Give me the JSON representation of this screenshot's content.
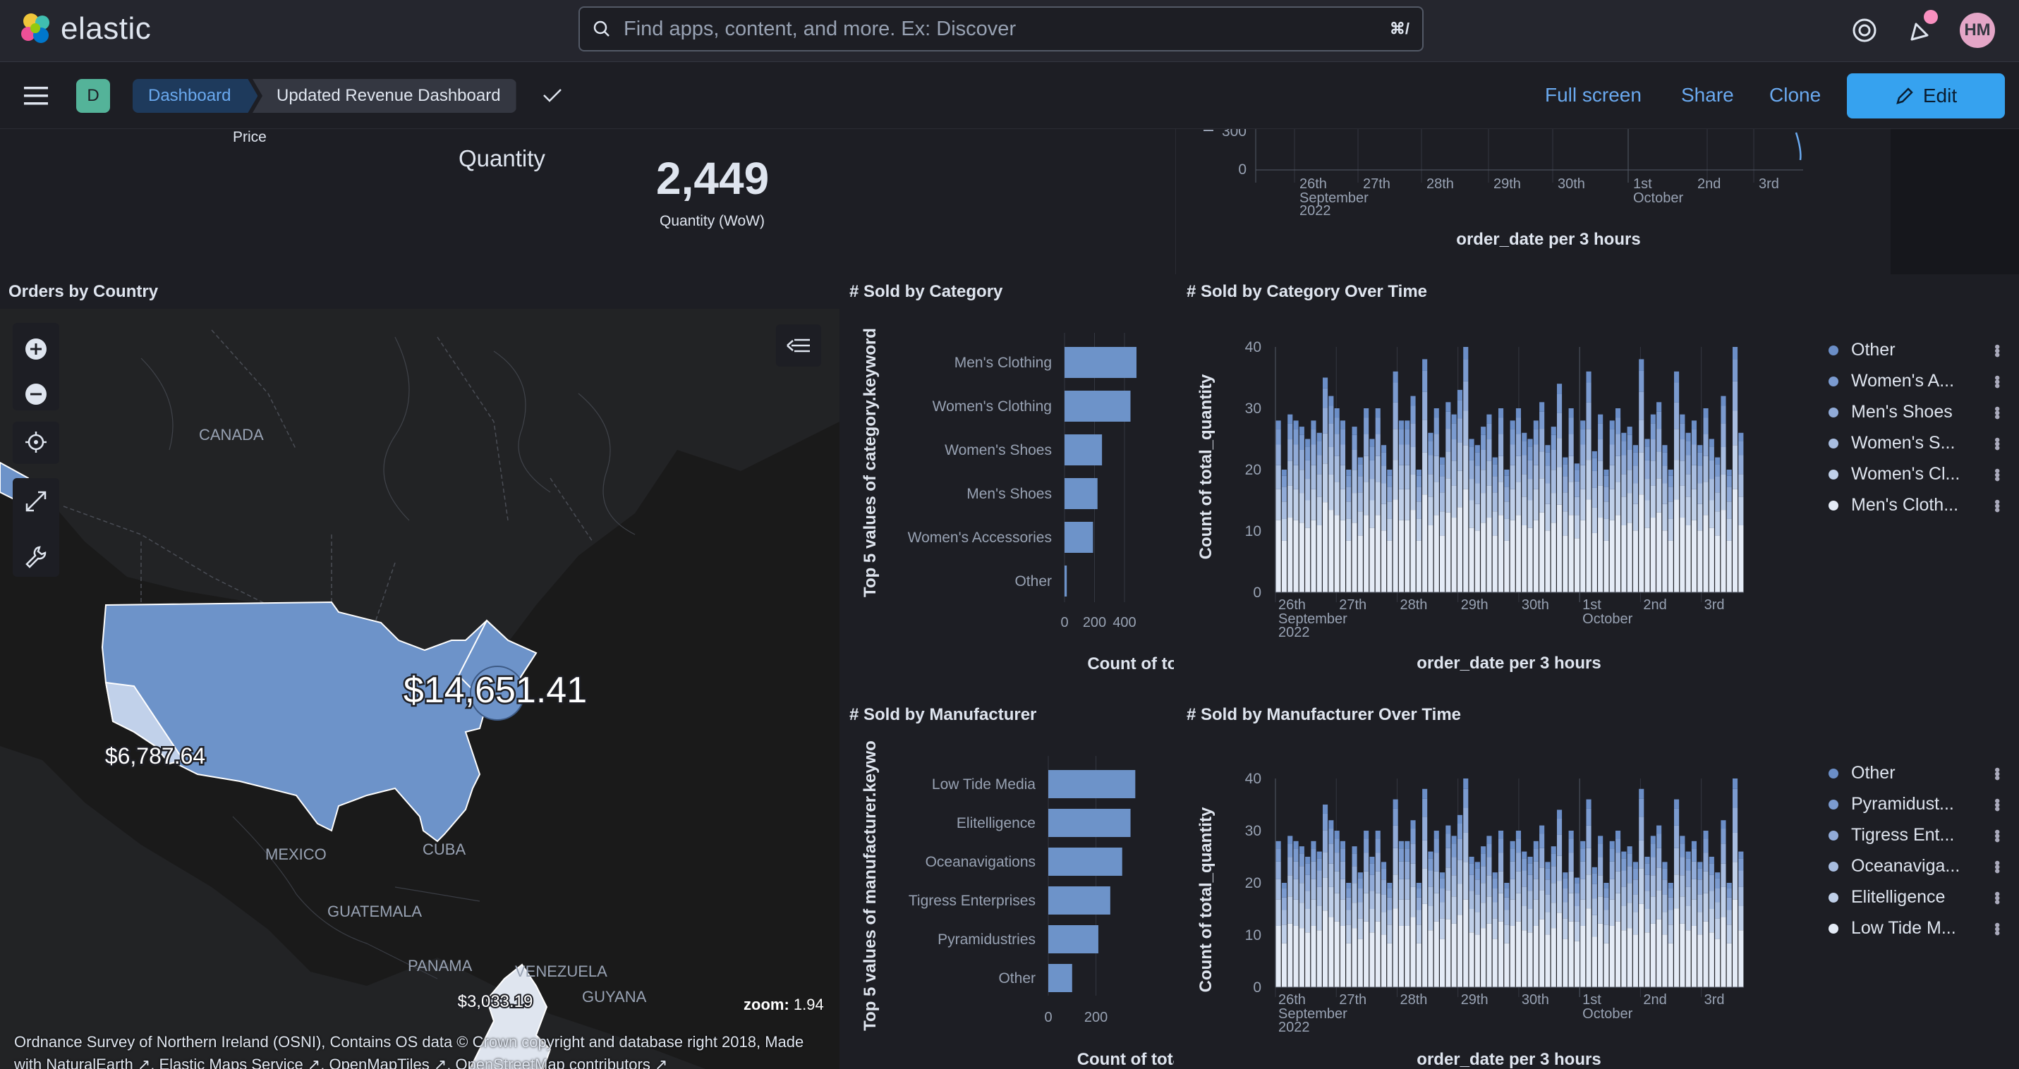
{
  "app": {
    "brand": "elastic",
    "user_initials": "HM"
  },
  "search": {
    "placeholder": "Find apps, content, and more. Ex: Discover",
    "shortcut": "⌘/"
  },
  "breadcrumb": {
    "root": "Dashboard",
    "current": "Updated Revenue Dashboard",
    "workspace_initial": "D"
  },
  "actions": {
    "fullscreen": "Full screen",
    "share": "Share",
    "clone": "Clone",
    "edit": "Edit"
  },
  "top_panels": {
    "price_label": "Price",
    "quantity_title": "Quantity",
    "quantity_value": "2,449",
    "quantity_sub": "Quantity (WoW)",
    "timeline_title": "order_date per 3 hours",
    "timeline_yticks": [
      "300",
      "0"
    ],
    "timeline_xticks": [
      "26th",
      "27th",
      "28th",
      "29th",
      "30th",
      "1st",
      "2nd",
      "3rd"
    ],
    "timeline_sub1": "September",
    "timeline_sub1b": "2022",
    "timeline_sub2": "October"
  },
  "map": {
    "title": "Orders by Country",
    "labels": {
      "canada": "CANADA",
      "mexico": "MEXICO",
      "cuba": "CUBA",
      "guatemala": "GUATEMALA",
      "panama": "PANAMA",
      "venezuela": "VENEZUELA",
      "guyana": "GUYANA"
    },
    "values": {
      "usa": "$14,651.41",
      "west": "$6,787.64",
      "colombia": "$3,033.19"
    },
    "zoom_label": "zoom:",
    "zoom_value": "1.94",
    "attribution_line1": "Ordnance Survey of Northern Ireland (OSNI), Contains OS data © Crown copyright and database right 2018, Made",
    "attribution_line2": "with NaturalEarth ↗, Elastic Maps Service ↗, OpenMapTiles ↗, OpenStreetMap contributors ↗"
  },
  "sold_by_category": {
    "title": "# Sold by Category",
    "ylabel": "Top 5 values of category.keyword",
    "xlabel": "Count of total_quar",
    "xticks": [
      "0",
      "200",
      "400"
    ]
  },
  "sold_by_manufacturer": {
    "title": "# Sold by Manufacturer",
    "ylabel": "Top 5 values of manufacturer.keywo",
    "xlabel": "Count of total_quant",
    "xticks": [
      "0",
      "200"
    ]
  },
  "category_over_time": {
    "title": "# Sold by Category Over Time",
    "ylabel": "Count of total_quantity",
    "xlabel": "order_date per 3 hours",
    "yticks": [
      "40",
      "30",
      "20",
      "10",
      "0"
    ],
    "xticks": [
      "26th",
      "27th",
      "28th",
      "29th",
      "30th",
      "1st",
      "2nd",
      "3rd"
    ],
    "sub1": "September",
    "sub1b": "2022",
    "sub2": "October",
    "legend": [
      "Other",
      "Women's A...",
      "Men's Shoes",
      "Women's S...",
      "Women's Cl...",
      "Men's Cloth..."
    ]
  },
  "manufacturer_over_time": {
    "title": "# Sold by Manufacturer Over Time",
    "ylabel": "Count of total_quantity",
    "xlabel": "order_date per 3 hours",
    "yticks": [
      "40",
      "30",
      "20",
      "10",
      "0"
    ],
    "xticks": [
      "26th",
      "27th",
      "28th",
      "29th",
      "30th",
      "1st",
      "2nd",
      "3rd"
    ],
    "sub1": "September",
    "sub1b": "2022",
    "sub2": "October",
    "legend": [
      "Other",
      "Pyramidust...",
      "Tigress Ent...",
      "Oceanaviga...",
      "Elitelligence",
      "Low Tide M..."
    ]
  },
  "chart_data": [
    {
      "type": "bar",
      "orientation": "horizontal",
      "title": "# Sold by Category",
      "categories": [
        "Men's Clothing",
        "Women's Clothing",
        "Women's Shoes",
        "Men's Shoes",
        "Women's Accessories",
        "Other"
      ],
      "values": [
        480,
        440,
        250,
        220,
        190,
        15
      ],
      "xlabel": "Count of total_quar",
      "ylabel": "Top 5 values of category.keyword",
      "xlim": [
        0,
        480
      ]
    },
    {
      "type": "bar",
      "orientation": "horizontal",
      "title": "# Sold by Manufacturer",
      "categories": [
        "Low Tide Media",
        "Elitelligence",
        "Oceanavigations",
        "Tigress Enterprises",
        "Pyramidustries",
        "Other"
      ],
      "values": [
        365,
        345,
        310,
        260,
        210,
        100
      ],
      "xlabel": "Count of total_quant",
      "ylabel": "Top 5 values of manufacturer.keywo",
      "xlim": [
        0,
        370
      ]
    },
    {
      "type": "bar",
      "stacked": true,
      "title": "# Sold by Category Over Time",
      "series_names": [
        "Other",
        "Women's A...",
        "Men's Shoes",
        "Women's S...",
        "Women's Cl...",
        "Men's Cloth..."
      ],
      "totals": [
        28,
        20,
        29,
        28,
        27,
        25,
        28,
        26,
        35,
        32,
        30,
        28,
        20,
        27,
        22,
        30,
        25,
        30,
        24,
        20,
        36,
        28,
        28,
        32,
        20,
        38,
        26,
        30,
        22,
        31,
        29,
        33,
        40,
        25,
        24,
        27,
        29,
        22,
        30,
        20,
        28,
        30,
        26,
        25,
        28,
        31,
        24,
        27,
        34,
        22,
        30,
        21,
        28,
        36,
        23,
        29,
        20,
        28,
        30,
        26,
        27,
        24,
        38,
        25,
        29,
        31,
        24,
        20,
        36,
        29,
        26,
        28,
        24,
        30,
        25,
        22,
        32,
        20,
        40,
        26
      ],
      "ylabel": "Count of total_quantity",
      "xlabel": "order_date per 3 hours",
      "ylim": [
        0,
        40
      ]
    },
    {
      "type": "bar",
      "stacked": true,
      "title": "# Sold by Manufacturer Over Time",
      "series_names": [
        "Other",
        "Pyramidust...",
        "Tigress Ent...",
        "Oceanaviga...",
        "Elitelligence",
        "Low Tide M..."
      ],
      "totals": [
        28,
        20,
        29,
        28,
        27,
        25,
        28,
        26,
        35,
        32,
        30,
        28,
        20,
        27,
        22,
        30,
        25,
        30,
        24,
        20,
        36,
        28,
        28,
        32,
        20,
        38,
        26,
        30,
        22,
        31,
        29,
        33,
        40,
        25,
        24,
        27,
        29,
        22,
        30,
        20,
        28,
        30,
        26,
        25,
        28,
        31,
        24,
        27,
        34,
        22,
        30,
        21,
        28,
        36,
        23,
        29,
        20,
        28,
        30,
        26,
        27,
        24,
        38,
        25,
        29,
        31,
        24,
        20,
        36,
        29,
        26,
        28,
        24,
        30,
        25,
        22,
        32,
        20,
        40,
        26
      ],
      "ylabel": "Count of total_quantity",
      "xlabel": "order_date per 3 hours",
      "ylim": [
        0,
        40
      ]
    }
  ],
  "colors": {
    "accent": "#36a2ef",
    "bar": "#6d93c9",
    "legend_dots": [
      "#6b8ec7",
      "#7b9bd0",
      "#91abd8",
      "#a8bde0",
      "#c0d0e9",
      "#e4ebf6"
    ]
  }
}
